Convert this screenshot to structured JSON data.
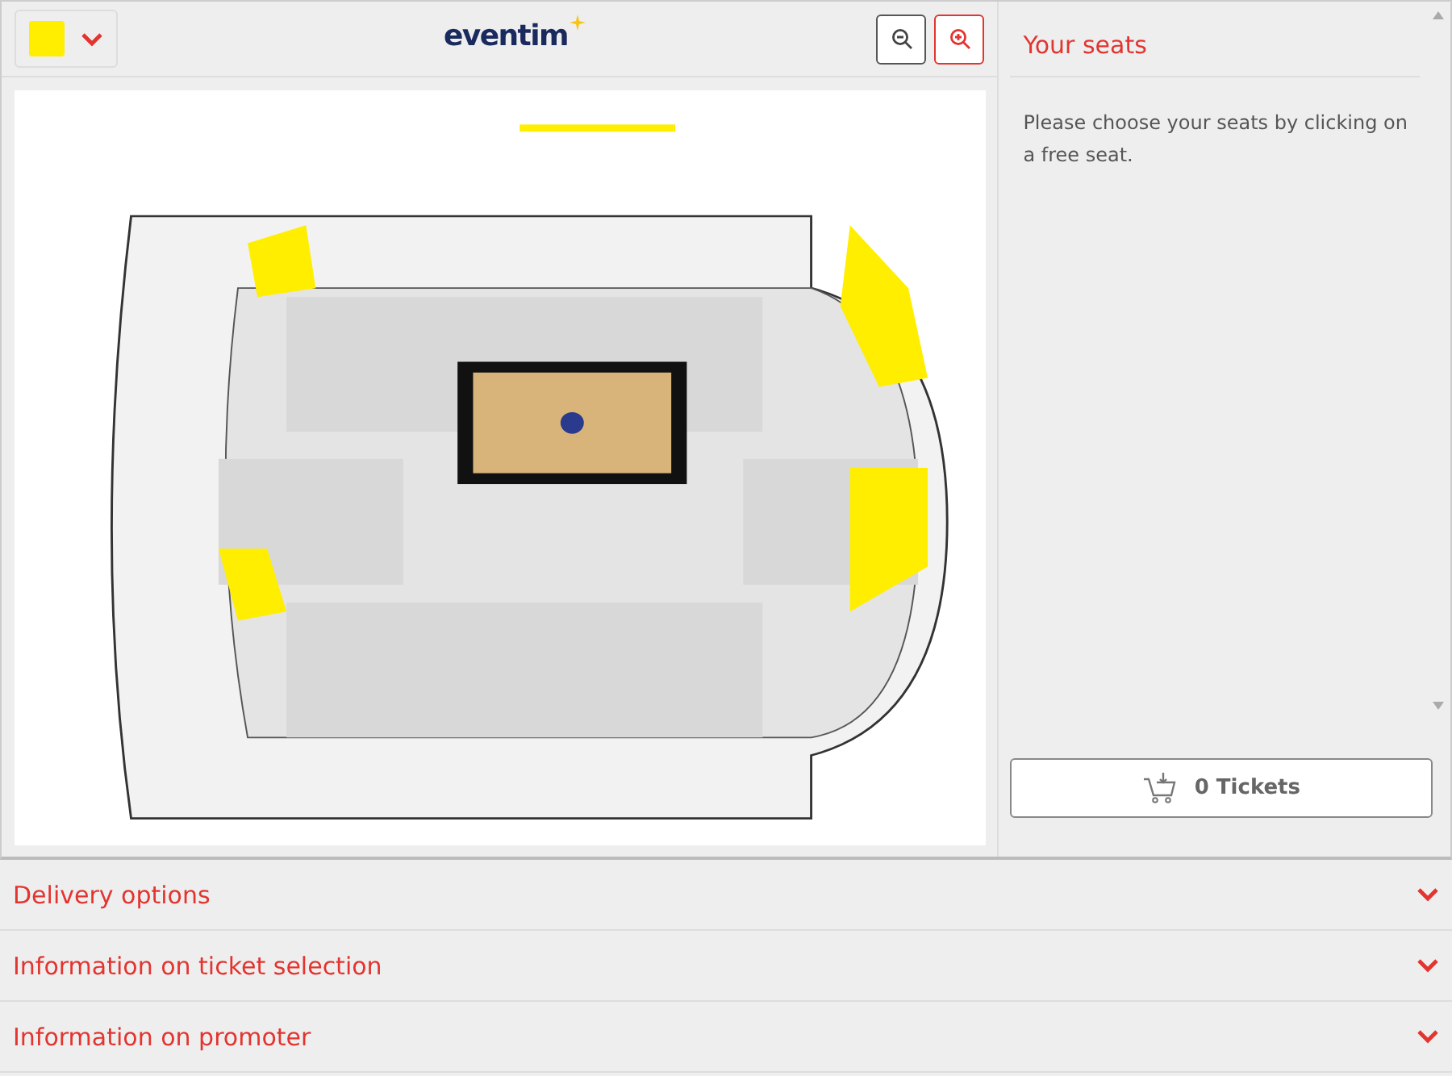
{
  "toolbar": {
    "category_select": {
      "color": "#ffee00",
      "expanded": false
    },
    "logo": {
      "text": "eventim"
    }
  },
  "sidebar": {
    "title": "Your seats",
    "hint": "Please choose your seats by clicking on a free seat.",
    "cart_button": {
      "label": "0 Tickets"
    }
  },
  "sections": [
    {
      "title": "Delivery options",
      "expanded": false
    },
    {
      "title": "Information on ticket selection",
      "expanded": false
    },
    {
      "title": "Information on promoter",
      "expanded": false
    }
  ]
}
